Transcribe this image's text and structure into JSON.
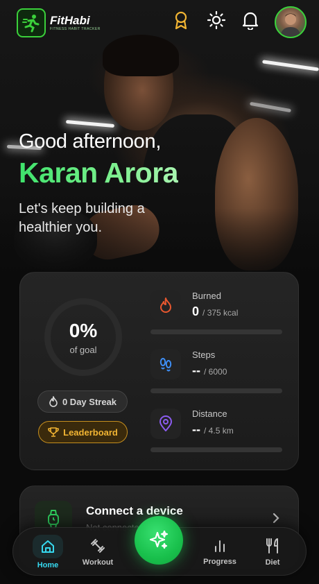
{
  "app": {
    "logo_title": "FitHabi",
    "logo_tagline": "FITNESS HABIT TRACKER"
  },
  "header": {
    "icons": [
      "award-icon",
      "sun-icon",
      "bell-icon"
    ],
    "greeting": "Good afternoon,",
    "user_name": "Karan Arora",
    "subtitle": "Let's keep building a healthier you."
  },
  "goal": {
    "percent_label": "0%",
    "percent_value": 0,
    "caption": "of goal"
  },
  "streak": {
    "label": "0 Day Streak"
  },
  "leaderboard": {
    "label": "Leaderboard"
  },
  "metrics": [
    {
      "label": "Burned",
      "value": "0",
      "target": "/ 375 kcal",
      "icon": "flame-icon",
      "color": "#e8572f",
      "progress": 0
    },
    {
      "label": "Steps",
      "value": "--",
      "target": "/ 6000",
      "icon": "footprints-icon",
      "color": "#3e8ef5",
      "progress": 0
    },
    {
      "label": "Distance",
      "value": "--",
      "target": "/ 4.5 km",
      "icon": "map-pin-icon",
      "color": "#8c5cf0",
      "progress": 0
    }
  ],
  "device": {
    "title": "Connect a device",
    "subtitle": "Not connected"
  },
  "nav": {
    "items": [
      {
        "label": "Home",
        "icon": "home-icon",
        "active": true
      },
      {
        "label": "Workout",
        "icon": "dumbbell-icon",
        "active": false
      },
      {
        "label": "Progress",
        "icon": "bar-chart-icon",
        "active": false
      },
      {
        "label": "Diet",
        "icon": "utensils-icon",
        "active": false
      }
    ],
    "fab_icon": "sparkles-icon"
  },
  "colors": {
    "brand_green": "#1fc451",
    "active_nav": "#36d9f0",
    "leaderboard_gold": "#f2b533"
  }
}
